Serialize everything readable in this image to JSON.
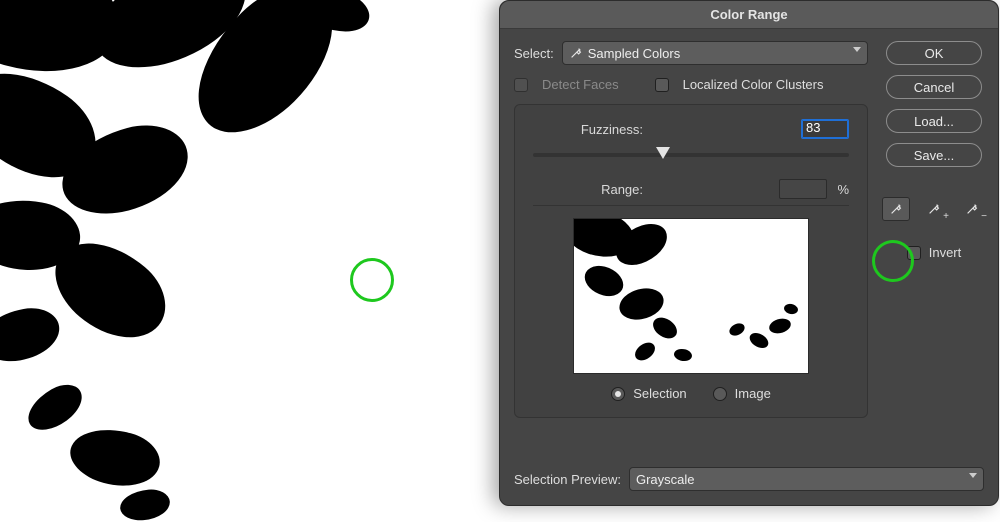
{
  "canvas": {
    "sample_cursor_color": "#1ec81e"
  },
  "dialog": {
    "title": "Color Range",
    "select_label": "Select:",
    "select_value": "Sampled Colors",
    "detect_faces": {
      "label": "Detect Faces",
      "checked": false,
      "enabled": false
    },
    "localized": {
      "label": "Localized Color Clusters",
      "checked": false
    },
    "fuzziness": {
      "label": "Fuzziness:",
      "value": "83",
      "min": 0,
      "max": 200,
      "slider_percent": 41
    },
    "range": {
      "label": "Range:",
      "value": "",
      "unit": "%",
      "enabled": false
    },
    "preview_mode": {
      "options": [
        "Selection",
        "Image"
      ],
      "selected": "Selection"
    },
    "selection_preview": {
      "label": "Selection Preview:",
      "value": "Grayscale"
    },
    "buttons": {
      "ok": "OK",
      "cancel": "Cancel",
      "load": "Load...",
      "save": "Save..."
    },
    "tools": {
      "eyedropper": "eyedropper",
      "eyedropper_add": "eyedropper-add",
      "eyedropper_sub": "eyedropper-subtract",
      "active": "eyedropper"
    },
    "invert": {
      "label": "Invert",
      "checked": false
    }
  }
}
